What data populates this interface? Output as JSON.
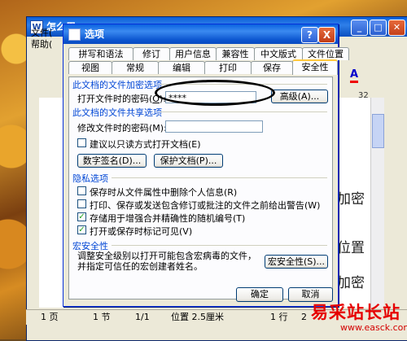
{
  "word": {
    "title": "怎么用",
    "menu": [
      "文件(",
      "帮助("
    ],
    "ruler_number": "32",
    "doc_text": [
      "加密",
      "位置",
      "加密"
    ],
    "status": {
      "page": "1 页",
      "section": "1 节",
      "page_of": "1/1",
      "position": "位置 2.5厘米",
      "line": "1 行",
      "col": "2"
    }
  },
  "dialog": {
    "title": "选项",
    "help_btn": "?",
    "close_btn": "X",
    "tabs_row1": [
      "拼写和语法",
      "修订",
      "用户信息",
      "兼容性",
      "中文版式",
      "文件位置"
    ],
    "tabs_row2": [
      "视图",
      "常规",
      "编辑",
      "打印",
      "保存",
      "安全性"
    ],
    "active_tab": "安全性",
    "encrypt": {
      "section": "此文档的文件加密选项",
      "open_pwd_label": "打开文件时的密码",
      "open_pwd_key": "O",
      "open_pwd_value": "****",
      "advanced_btn": "高级(A)..."
    },
    "share": {
      "section": "此文档的文件共享选项",
      "modify_pwd_label": "修改文件时的密码(M):",
      "modify_pwd_value": "",
      "readonly_label": "建议以只读方式打开文档(E)",
      "readonly_checked": false,
      "digital_sig_btn": "数字签名(D)...",
      "protect_doc_btn": "保护文档(P)..."
    },
    "privacy": {
      "section": "隐私选项",
      "options": [
        {
          "label": "保存时从文件属性中删除个人信息(R)",
          "checked": false
        },
        {
          "label": "打印、保存或发送包含修订或批注的文件之前给出警告(W)",
          "checked": false
        },
        {
          "label": "存储用于增强合并精确性的随机编号(T)",
          "checked": true
        },
        {
          "label": "打开或保存时标记可见(V)",
          "checked": true
        }
      ]
    },
    "macro": {
      "section": "宏安全性",
      "desc": "调整安全级别以打开可能包含宏病毒的文件，并指定可信任的宏创建者姓名。",
      "macro_btn": "宏安全性(S)..."
    },
    "ok_btn": "确定",
    "cancel_btn": "取消"
  },
  "watermark": {
    "main": "易采站长站",
    "url": "www.easck.com"
  }
}
